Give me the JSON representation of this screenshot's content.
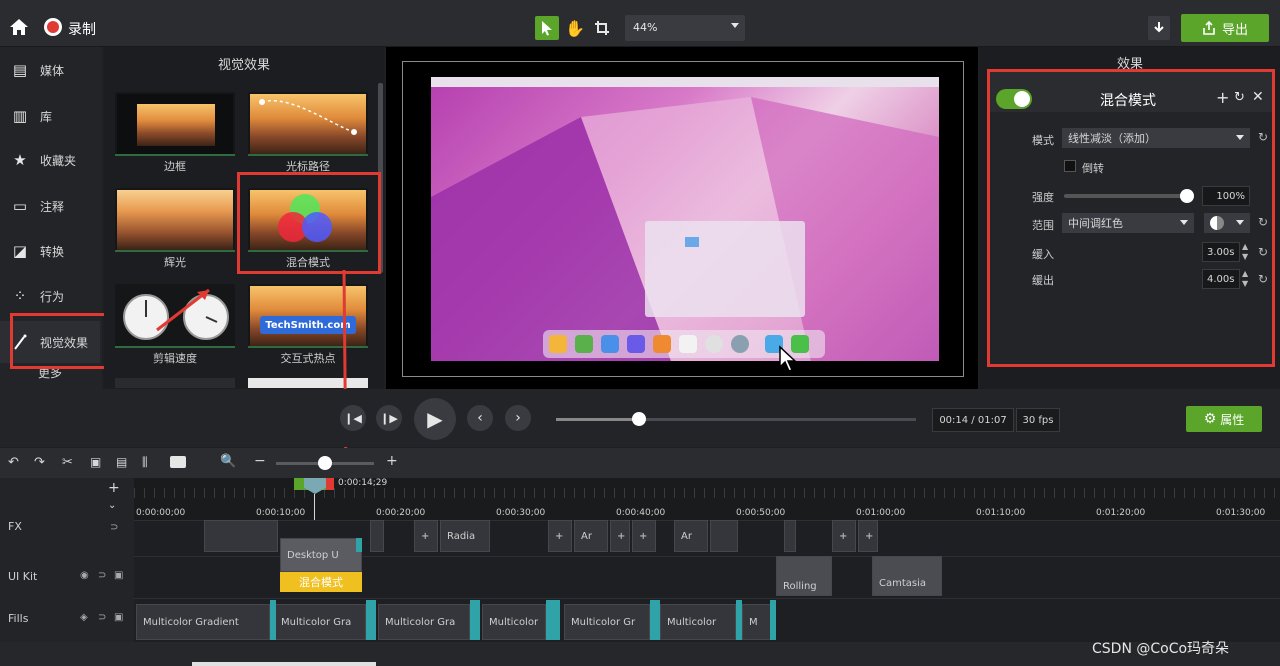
{
  "app": {
    "record_label": "录制",
    "zoom_value": "44%",
    "export_label": "导出"
  },
  "colors": {
    "accent_green": "#5aa52a",
    "highlight_red": "#e03a32",
    "yellow_clip": "#f0c020"
  },
  "sidebar": {
    "items": [
      {
        "label": "媒体",
        "icon": "film-icon"
      },
      {
        "label": "库",
        "icon": "library-icon"
      },
      {
        "label": "收藏夹",
        "icon": "star-icon"
      },
      {
        "label": "注释",
        "icon": "annotation-icon"
      },
      {
        "label": "转换",
        "icon": "transition-icon"
      },
      {
        "label": "行为",
        "icon": "behavior-icon"
      },
      {
        "label": "视觉效果",
        "icon": "magic-wand-icon"
      },
      {
        "label": "更多",
        "icon": "more-icon"
      }
    ]
  },
  "effects_panel": {
    "title": "视觉效果",
    "thumbs": [
      {
        "label": "边框"
      },
      {
        "label": "光标路径"
      },
      {
        "label": "辉光"
      },
      {
        "label": "混合模式"
      },
      {
        "label": "剪辑速度"
      },
      {
        "label": "交互式热点"
      }
    ],
    "techsmith_text": "TechSmith.com"
  },
  "properties": {
    "panel_title": "效果",
    "effect_name": "混合模式",
    "mode_label": "模式",
    "mode_value": "线性减淡（添加）",
    "invert_label": "倒转",
    "intensity_label": "强度",
    "intensity_value": "100%",
    "range_label": "范围",
    "range_value": "中间调红色",
    "fade_in_label": "缓入",
    "fade_in_value": "3.00s",
    "fade_out_label": "缓出",
    "fade_out_value": "4.00s"
  },
  "playback": {
    "time": "00:14 / 01:07",
    "fps": "30 fps",
    "properties_label": "属性"
  },
  "timeline": {
    "playhead_time": "0:00:14;29",
    "ticks": [
      "0:00:00;00",
      "0:00:10;00",
      "0:00:20;00",
      "0:00:30;00",
      "0:00:40;00",
      "0:00:50;00",
      "0:01:00;00",
      "0:01:10;00",
      "0:01:20;00",
      "0:01:30;00"
    ],
    "tracks": [
      {
        "name": "FX"
      },
      {
        "name": "UI Kit"
      },
      {
        "name": "Fills"
      }
    ],
    "clips": {
      "radial": "Radia",
      "ar1": "Ar",
      "ar2": "Ar",
      "desktop": "Desktop U",
      "blend": "混合模式",
      "rolling": "Rolling",
      "camtasia": "Camtasia",
      "mg1": "Multicolor Gradient",
      "mg2": "Multicolor Gra",
      "mg3": "Multicolor Gra",
      "mg4": "Multicolor",
      "mg5": "Multicolor Gr",
      "mg6": "Multicolor",
      "mg7": "M"
    }
  },
  "watermark": "CSDN @CoCo玛奇朵"
}
